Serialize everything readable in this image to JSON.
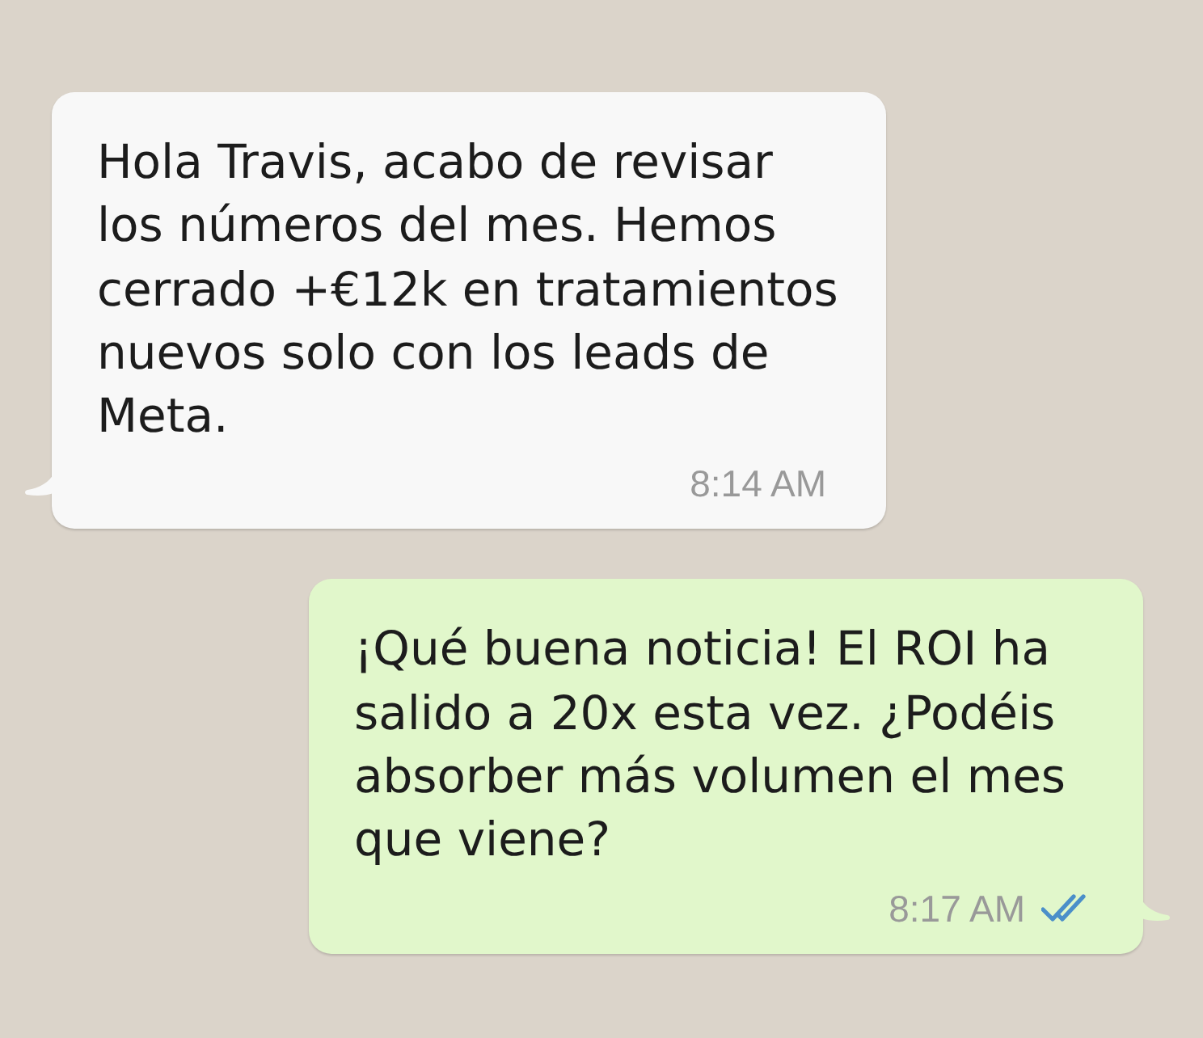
{
  "messages": [
    {
      "kind": "incoming",
      "text": "Hola Travis, acabo de revisar los números del mes. Hemos cerrado +€12k en tratamientos nuevos solo con los leads de Meta.",
      "time": "8:14 AM"
    },
    {
      "kind": "outgoing",
      "text": "¡Qué buena noticia! El ROI ha salido a 20x esta vez. ¿Podéis absorber más volumen el mes que viene?",
      "time": "8:17 AM",
      "read": true
    }
  ]
}
